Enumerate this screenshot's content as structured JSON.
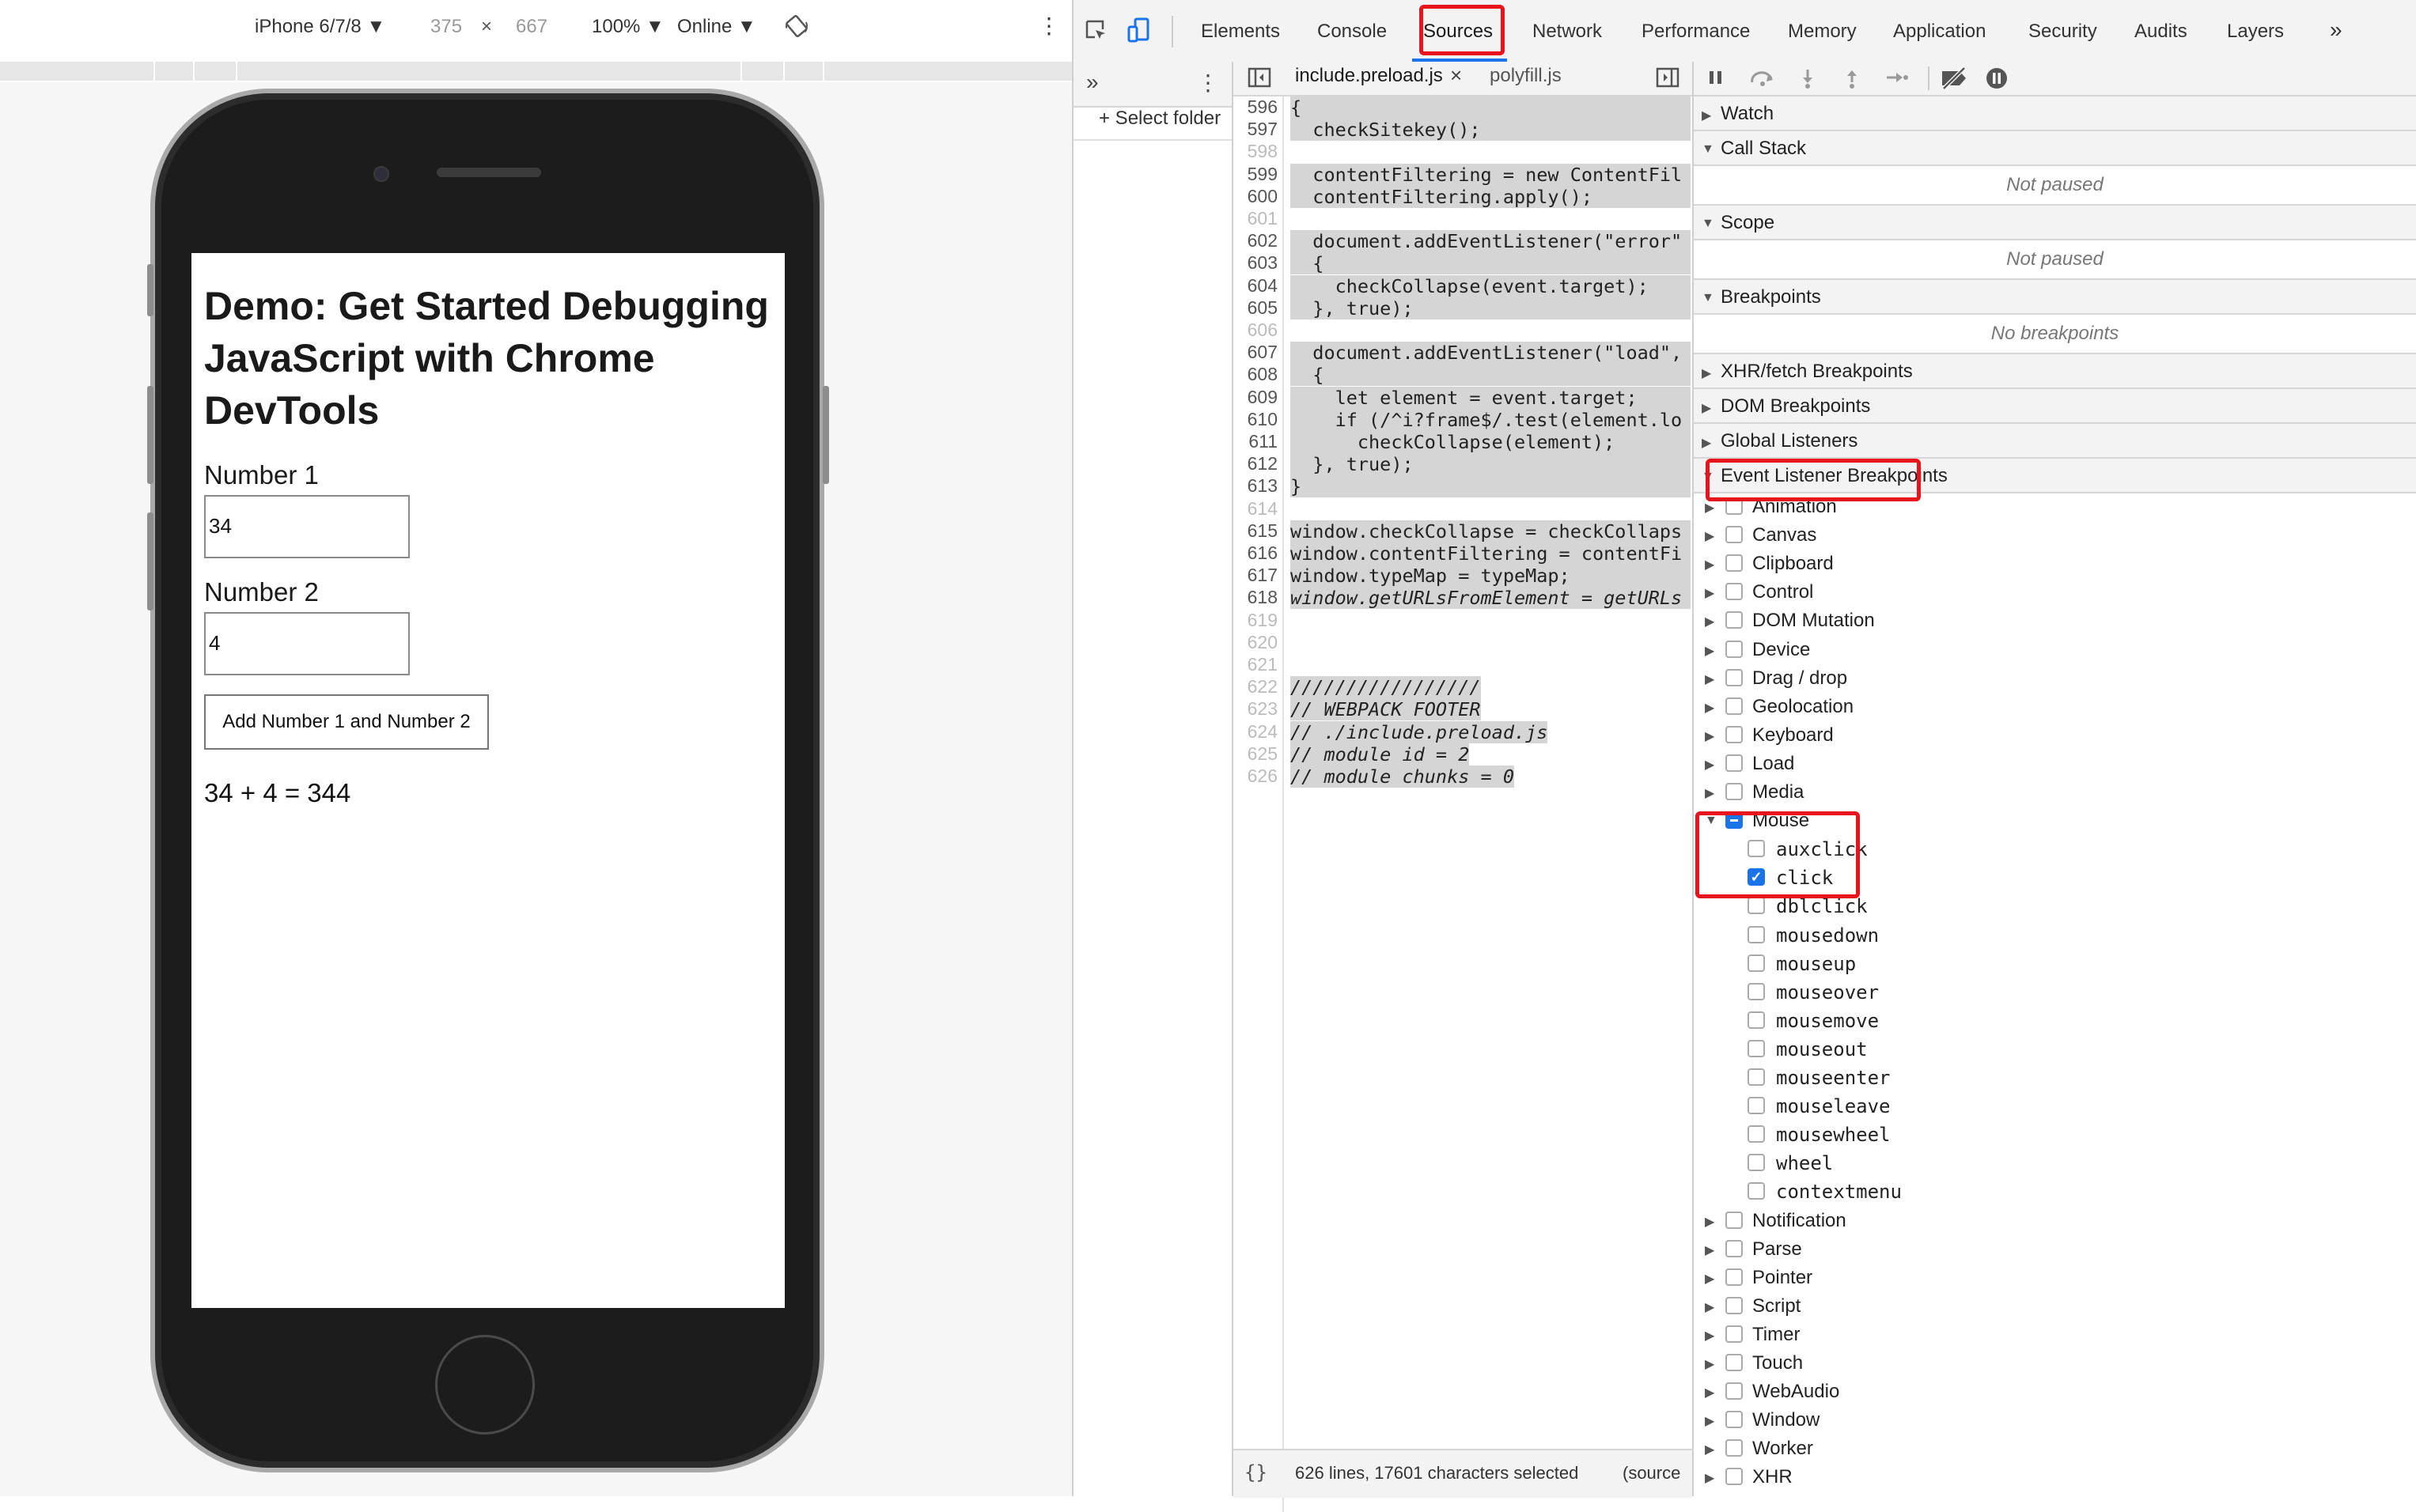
{
  "device_toolbar": {
    "device": "iPhone 6/7/8 ▼",
    "width": "375",
    "times": "×",
    "height": "667",
    "zoom": "100% ▼",
    "network": "Online ▼",
    "more": "⋮"
  },
  "page": {
    "title": "Demo: Get Started Debugging JavaScript with Chrome DevTools",
    "label1": "Number 1",
    "value1": "34",
    "label2": "Number 2",
    "value2": "4",
    "button": "Add Number 1 and Number 2",
    "result": "34 + 4 = 344"
  },
  "devtools": {
    "tabs": [
      "Elements",
      "Console",
      "Sources",
      "Network",
      "Performance",
      "Memory",
      "Application",
      "Security",
      "Audits",
      "Layers"
    ],
    "active_tab": "Sources",
    "overflow": "»"
  },
  "navigator": {
    "chevron": "»",
    "menu": "⋮",
    "select_folder": "+ Select folder"
  },
  "editor": {
    "tabs": [
      {
        "name": "include.preload.js",
        "close": "×"
      },
      {
        "name": "polyfill.js"
      }
    ],
    "lines": [
      {
        "n": "596",
        "code": "{",
        "dim": false
      },
      {
        "n": "597",
        "code": "  checkSitekey();",
        "dim": false
      },
      {
        "n": "598",
        "code": "",
        "dim": true
      },
      {
        "n": "599",
        "code": "  contentFiltering = new ContentFil",
        "dim": false
      },
      {
        "n": "600",
        "code": "  contentFiltering.apply();",
        "dim": false
      },
      {
        "n": "601",
        "code": "",
        "dim": true
      },
      {
        "n": "602",
        "code": "  document.addEventListener(\"error\"",
        "dim": false
      },
      {
        "n": "603",
        "code": "  {",
        "dim": false
      },
      {
        "n": "604",
        "code": "    checkCollapse(event.target);",
        "dim": false
      },
      {
        "n": "605",
        "code": "  }, true);",
        "dim": false
      },
      {
        "n": "606",
        "code": "",
        "dim": true
      },
      {
        "n": "607",
        "code": "  document.addEventListener(\"load\",",
        "dim": false
      },
      {
        "n": "608",
        "code": "  {",
        "dim": false
      },
      {
        "n": "609",
        "code": "    let element = event.target;",
        "dim": false
      },
      {
        "n": "610",
        "code": "    if (/^i?frame$/.test(element.lo",
        "dim": false
      },
      {
        "n": "611",
        "code": "      checkCollapse(element);",
        "dim": false
      },
      {
        "n": "612",
        "code": "  }, true);",
        "dim": false
      },
      {
        "n": "613",
        "code": "}",
        "dim": false
      },
      {
        "n": "614",
        "code": "",
        "dim": true
      },
      {
        "n": "615",
        "code": "window.checkCollapse = checkCollaps",
        "dim": false
      },
      {
        "n": "616",
        "code": "window.contentFiltering = contentFi",
        "dim": false
      },
      {
        "n": "617",
        "code": "window.typeMap = typeMap;",
        "dim": false
      },
      {
        "n": "618",
        "code": "window.getURLsFromElement = getURLs",
        "dim": false
      },
      {
        "n": "619",
        "code": "",
        "dim": true
      },
      {
        "n": "620",
        "code": "",
        "dim": true
      },
      {
        "n": "621",
        "code": "",
        "dim": true
      },
      {
        "n": "622",
        "code": "/////////////////",
        "dim": true
      },
      {
        "n": "623",
        "code": "// WEBPACK FOOTER",
        "dim": true
      },
      {
        "n": "624",
        "code": "// ./include.preload.js",
        "dim": true
      },
      {
        "n": "625",
        "code": "// module id = 2",
        "dim": true
      },
      {
        "n": "626",
        "code": "// module chunks = 0",
        "dim": true
      }
    ],
    "status": "626 lines, 17601 characters selected",
    "status_tail": "(source",
    "pretty": "{}"
  },
  "debugger": {
    "watch": "Watch",
    "call_stack": "Call Stack",
    "call_stack_body": "Not paused",
    "scope": "Scope",
    "scope_body": "Not paused",
    "breakpoints": "Breakpoints",
    "breakpoints_body": "No breakpoints",
    "xhr": "XHR/fetch Breakpoints",
    "dom": "DOM Breakpoints",
    "global": "Global Listeners",
    "elb": "Event Listener Breakpoints",
    "categories_before": [
      "Animation",
      "Canvas",
      "Clipboard",
      "Control",
      "DOM Mutation",
      "Device",
      "Drag / drop",
      "Geolocation",
      "Keyboard",
      "Load",
      "Media"
    ],
    "mouse": "Mouse",
    "mouse_events": [
      {
        "name": "auxclick",
        "checked": false
      },
      {
        "name": "click",
        "checked": true
      },
      {
        "name": "dblclick",
        "checked": false
      },
      {
        "name": "mousedown",
        "checked": false
      },
      {
        "name": "mouseup",
        "checked": false
      },
      {
        "name": "mouseover",
        "checked": false
      },
      {
        "name": "mousemove",
        "checked": false
      },
      {
        "name": "mouseout",
        "checked": false
      },
      {
        "name": "mouseenter",
        "checked": false
      },
      {
        "name": "mouseleave",
        "checked": false
      },
      {
        "name": "mousewheel",
        "checked": false
      },
      {
        "name": "wheel",
        "checked": false
      },
      {
        "name": "contextmenu",
        "checked": false
      }
    ],
    "categories_after": [
      "Notification",
      "Parse",
      "Pointer",
      "Script",
      "Timer",
      "Touch",
      "WebAudio",
      "Window",
      "Worker",
      "XHR"
    ]
  }
}
